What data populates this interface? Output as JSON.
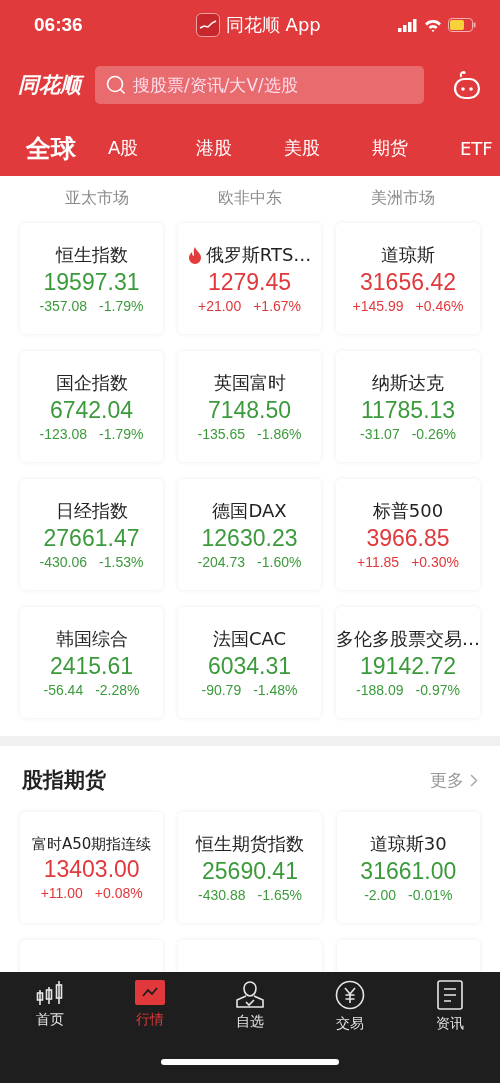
{
  "status_bar": {
    "time": "06:36",
    "app_title": "同花顺 App"
  },
  "header": {
    "logo": "同花顺",
    "search": {
      "placeholder": "搜股票/资讯/大V/选股"
    }
  },
  "tabs": [
    {
      "label": "全球",
      "selected": true
    },
    {
      "label": "A股",
      "selected": false
    },
    {
      "label": "港股",
      "selected": false
    },
    {
      "label": "美股",
      "selected": false
    },
    {
      "label": "期货",
      "selected": false
    },
    {
      "label": "ETF",
      "selected": false
    }
  ],
  "region_headers": [
    "亚太市场",
    "欧非中东",
    "美洲市场"
  ],
  "indices": [
    {
      "name": "恒生指数",
      "value": "19597.31",
      "change": "-357.08",
      "percent": "-1.79%",
      "kind": "down",
      "hot": false
    },
    {
      "name": "俄罗斯RTS…",
      "value": "1279.45",
      "change": "+21.00",
      "percent": "+1.67%",
      "kind": "up",
      "hot": true
    },
    {
      "name": "道琼斯",
      "value": "31656.42",
      "change": "+145.99",
      "percent": "+0.46%",
      "kind": "up",
      "hot": false
    },
    {
      "name": "国企指数",
      "value": "6742.04",
      "change": "-123.08",
      "percent": "-1.79%",
      "kind": "down",
      "hot": false
    },
    {
      "name": "英国富时",
      "value": "7148.50",
      "change": "-135.65",
      "percent": "-1.86%",
      "kind": "down",
      "hot": false
    },
    {
      "name": "纳斯达克",
      "value": "11785.13",
      "change": "-31.07",
      "percent": "-0.26%",
      "kind": "down",
      "hot": false
    },
    {
      "name": "日经指数",
      "value": "27661.47",
      "change": "-430.06",
      "percent": "-1.53%",
      "kind": "down",
      "hot": false
    },
    {
      "name": "德国DAX",
      "value": "12630.23",
      "change": "-204.73",
      "percent": "-1.60%",
      "kind": "down",
      "hot": false
    },
    {
      "name": "标普500",
      "value": "3966.85",
      "change": "+11.85",
      "percent": "+0.30%",
      "kind": "up",
      "hot": false
    },
    {
      "name": "韩国综合",
      "value": "2415.61",
      "change": "-56.44",
      "percent": "-2.28%",
      "kind": "down",
      "hot": false
    },
    {
      "name": "法国CAC",
      "value": "6034.31",
      "change": "-90.79",
      "percent": "-1.48%",
      "kind": "down",
      "hot": false
    },
    {
      "name": "多伦多股票交易…",
      "value": "19142.72",
      "change": "-188.09",
      "percent": "-0.97%",
      "kind": "down",
      "hot": false
    }
  ],
  "futures": {
    "title": "股指期货",
    "more": "更多",
    "items": [
      {
        "name": "富时A50期指连续",
        "value": "13403.00",
        "change": "+11.00",
        "percent": "+0.08%",
        "kind": "up",
        "hot": false
      },
      {
        "name": "恒生期货指数",
        "value": "25690.41",
        "change": "-430.88",
        "percent": "-1.65%",
        "kind": "down",
        "hot": false
      },
      {
        "name": "道琼斯30",
        "value": "31661.00",
        "change": "-2.00",
        "percent": "-0.01%",
        "kind": "down",
        "hot": false
      }
    ]
  },
  "bottom_nav": [
    {
      "label": "首页",
      "kind": "candles",
      "selected": false
    },
    {
      "label": "行情",
      "kind": "chart",
      "selected": true
    },
    {
      "label": "自选",
      "kind": "person",
      "selected": false
    },
    {
      "label": "交易",
      "kind": "yen",
      "selected": false
    },
    {
      "label": "资讯",
      "kind": "doc",
      "selected": false
    }
  ]
}
